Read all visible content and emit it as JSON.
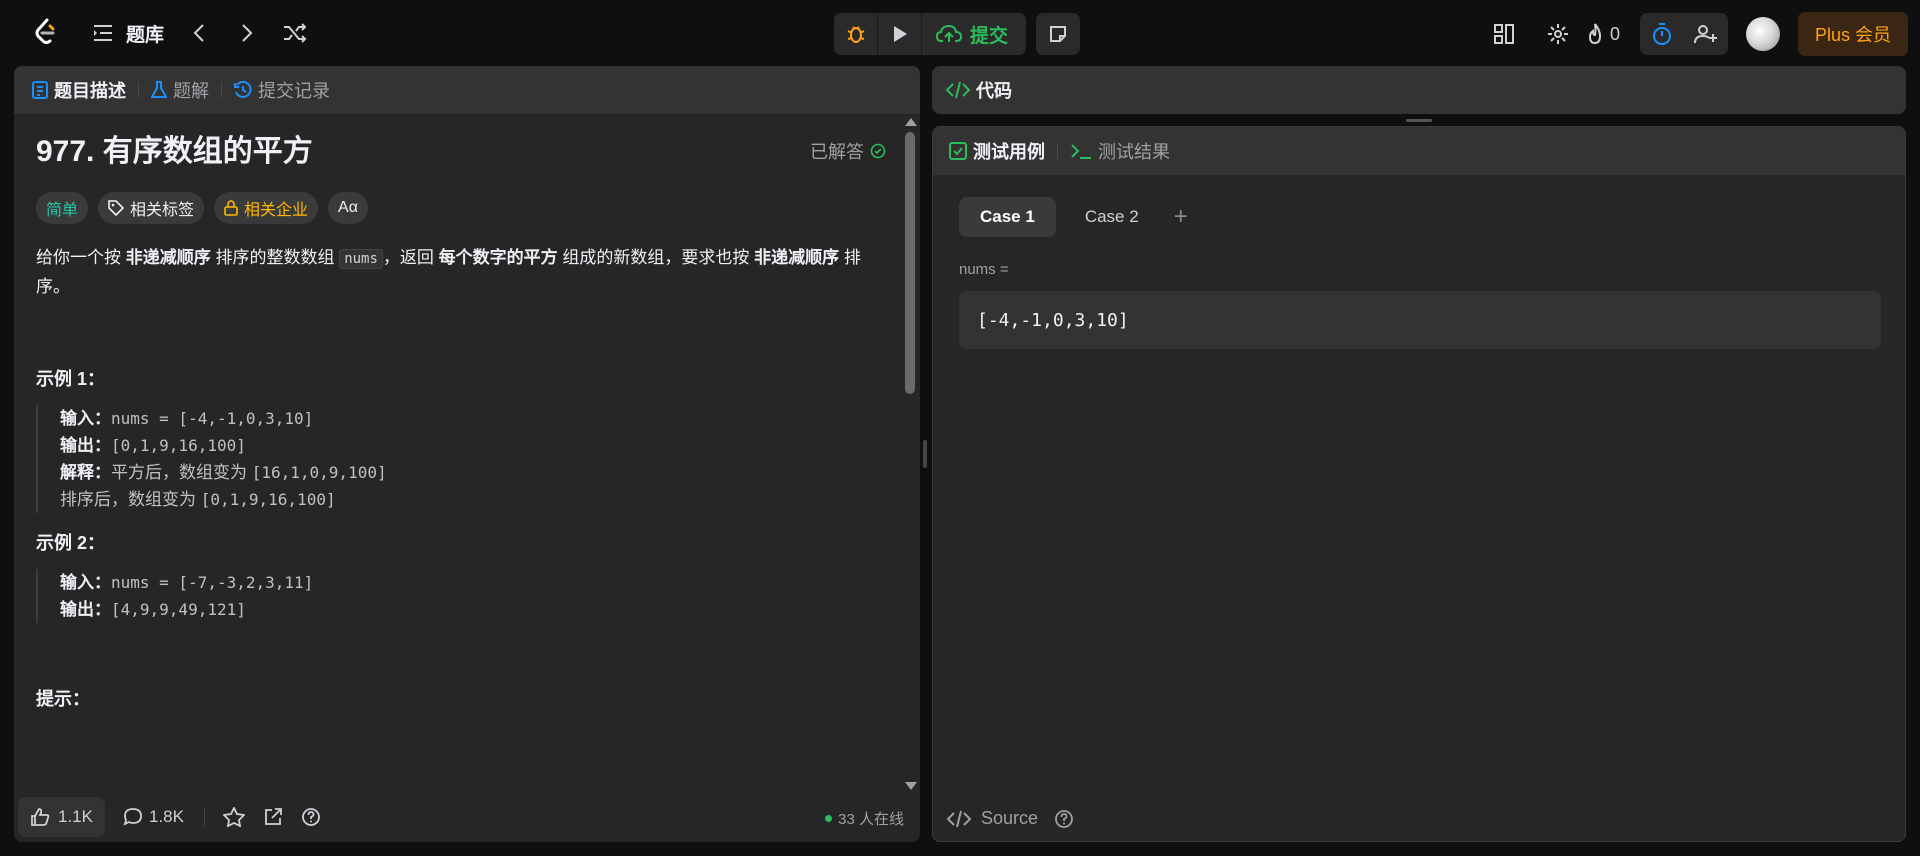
{
  "topbar": {
    "title": "题库",
    "submit_label": "提交",
    "fire_count": "0",
    "plus_label": "Plus 会员"
  },
  "left_panel": {
    "tabs": [
      {
        "label": "题目描述",
        "icon": "description-icon"
      },
      {
        "label": "题解",
        "icon": "flask-icon"
      },
      {
        "label": "提交记录",
        "icon": "history-icon"
      }
    ],
    "problem_title": "977. 有序数组的平方",
    "solved_label": "已解答",
    "tags": {
      "difficulty": "简单",
      "topics": "相关标签",
      "companies": "相关企业",
      "translate": "Aα"
    },
    "statement": {
      "p1": "给你一个按 ",
      "b1": "非递减顺序",
      "p2": " 排序的整数数组 ",
      "code": "nums",
      "p3": "，返回 ",
      "b2": "每个数字的平方",
      "p4": " 组成的新数组，要求也按 ",
      "b3": "非递减顺序",
      "p5": " 排序。"
    },
    "example1": {
      "title": "示例 1：",
      "input_label": "输入：",
      "input": "nums = [-4,-1,0,3,10]",
      "output_label": "输出：",
      "output": "[0,1,9,16,100]",
      "explain_label": "解释：",
      "explain_pre": "平方后，数组变为 ",
      "explain_val": "[16,1,0,9,100]",
      "explain2_pre": "排序后，数组变为 ",
      "explain2_val": "[0,1,9,16,100]"
    },
    "example2": {
      "title": "示例 2：",
      "input_label": "输入：",
      "input": "nums = [-7,-3,2,3,11]",
      "output_label": "输出：",
      "output": "[4,9,9,49,121]"
    },
    "hints_title": "提示：",
    "footer": {
      "likes": "1.1K",
      "comments": "1.8K",
      "online": "33 人在线"
    }
  },
  "code_panel": {
    "title": "代码"
  },
  "test_panel": {
    "tabs": [
      {
        "label": "测试用例",
        "icon": "checkbox-icon"
      },
      {
        "label": "测试结果",
        "icon": "terminal-icon"
      }
    ],
    "cases": [
      "Case 1",
      "Case 2"
    ],
    "add_case": "+",
    "param_label": "nums =",
    "param_value": "[-4,-1,0,3,10]",
    "source_label": "Source"
  },
  "colors": {
    "accent_green": "#2cbb5d",
    "brand_orange": "#ffa116",
    "easy_teal": "#22c5a8",
    "tab_blue": "#1a90ff"
  }
}
